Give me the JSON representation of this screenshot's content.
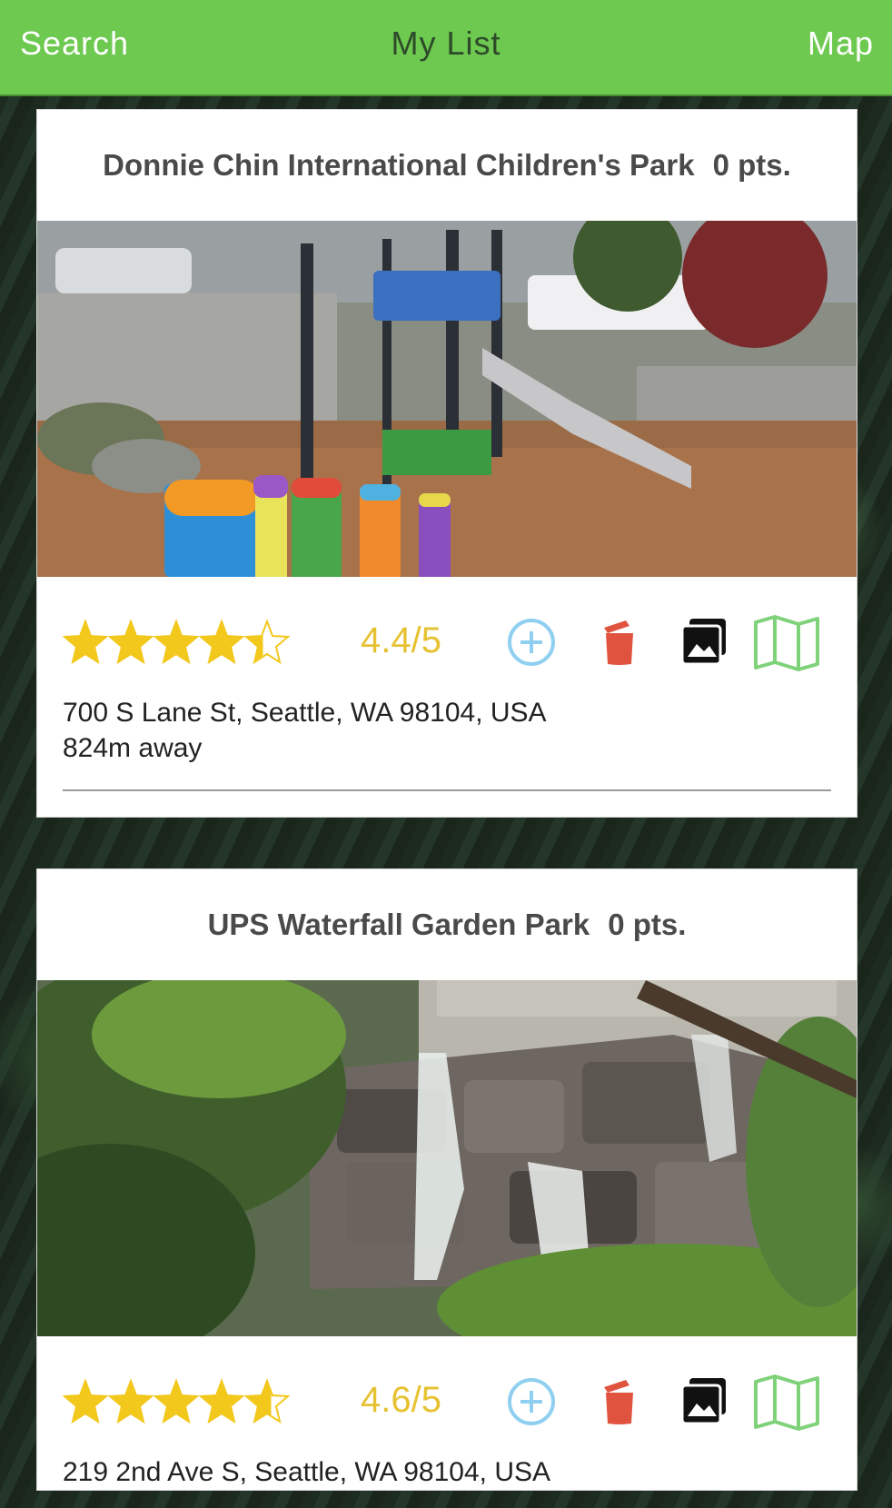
{
  "navbar": {
    "search_label": "Search",
    "title": "My List",
    "map_label": "Map",
    "color": "#6dc94f"
  },
  "places": [
    {
      "name": "Donnie Chin International Children's Park",
      "points": "0 pts.",
      "rating_text": "4.4/5",
      "rating_value": 4.4,
      "address": "700 S Lane St, Seattle, WA 98104, USA",
      "distance": "824m away",
      "photo_subject": "playground"
    },
    {
      "name": "UPS Waterfall Garden Park",
      "points": "0 pts.",
      "rating_text": "4.6/5",
      "rating_value": 4.6,
      "address": "219 2nd Ave S, Seattle, WA 98104, USA",
      "distance": "",
      "photo_subject": "waterfall"
    }
  ],
  "icons": {
    "add": "add-circle-icon",
    "trash": "trash-icon",
    "photos": "photo-gallery-icon",
    "map": "map-icon",
    "star": "star-icon"
  },
  "colors": {
    "star": "#f2c81c",
    "rating": "#e6c233",
    "add": "#8fcff0",
    "trash": "#e0533f",
    "map": "#7fd27a"
  }
}
